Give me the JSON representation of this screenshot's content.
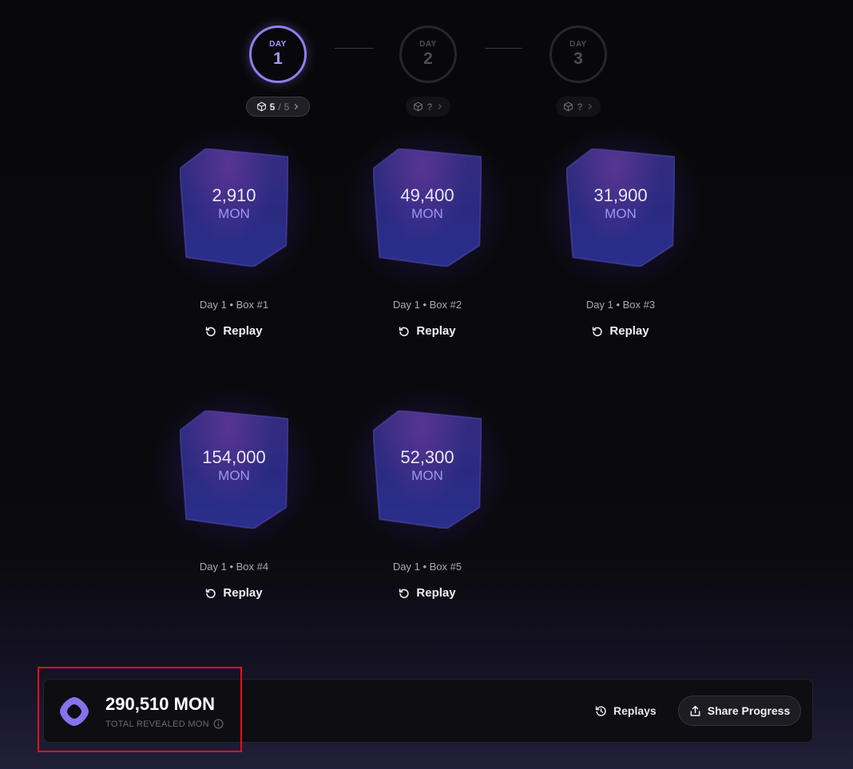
{
  "stepper": {
    "days": [
      {
        "label": "DAY",
        "number": "1",
        "state": "active",
        "opened": "5",
        "total": "5"
      },
      {
        "label": "DAY",
        "number": "2",
        "state": "locked",
        "opened": "?"
      },
      {
        "label": "DAY",
        "number": "3",
        "state": "locked",
        "opened": "?"
      }
    ],
    "pill_separator": "/",
    "pill_icon": "cube-icon",
    "pill_arrow_icon": "chevron-right-icon"
  },
  "boxes": [
    {
      "value": "2,910",
      "unit": "MON",
      "caption": "Day 1 • Box #1",
      "replay_label": "Replay"
    },
    {
      "value": "49,400",
      "unit": "MON",
      "caption": "Day 1 • Box #2",
      "replay_label": "Replay"
    },
    {
      "value": "31,900",
      "unit": "MON",
      "caption": "Day 1 • Box #3",
      "replay_label": "Replay"
    },
    {
      "value": "154,000",
      "unit": "MON",
      "caption": "Day 1 • Box #4",
      "replay_label": "Replay"
    },
    {
      "value": "52,300",
      "unit": "MON",
      "caption": "Day 1 • Box #5",
      "replay_label": "Replay"
    }
  ],
  "summary": {
    "total_value": "290,510 MON",
    "total_label": "TOTAL REVEALED MON",
    "info_icon": "info-icon",
    "token_icon": "monad-logo-icon",
    "replays_label": "Replays",
    "share_label": "Share Progress"
  },
  "colors": {
    "accent": "#8f7ff3",
    "highlight_border": "#e8101a",
    "cube_fill": "#2b2a82",
    "background": "#08080b"
  }
}
